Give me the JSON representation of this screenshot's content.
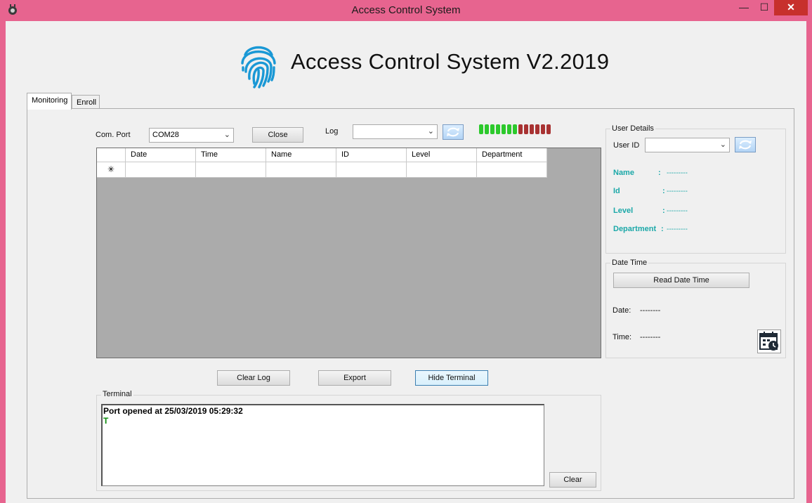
{
  "window": {
    "title": "Access Control System",
    "minimize_glyph": "—",
    "maximize_glyph": "☐",
    "close_glyph": "✕"
  },
  "header": {
    "title": "Access Control System V2.2019",
    "logo_icon": "fingerprint-icon",
    "logo_color": "#1a98d5"
  },
  "tabs": [
    {
      "label": "Monitoring",
      "active": true
    },
    {
      "label": "Enroll",
      "active": false
    }
  ],
  "connection": {
    "port_label": "Com. Port",
    "port_value": "COM28",
    "close_label": "Close",
    "log_label": "Log",
    "log_value": ""
  },
  "leds": {
    "colors": [
      "#2cc92c",
      "#2cc92c",
      "#2cc92c",
      "#2cc92c",
      "#2cc92c",
      "#2cc92c",
      "#2cc92c",
      "#a83232",
      "#a83232",
      "#a83232",
      "#a83232",
      "#a83232",
      "#a83232"
    ]
  },
  "grid": {
    "columns": [
      "Date",
      "Time",
      "Name",
      "ID",
      "Level",
      "Department"
    ],
    "new_row_marker": "✳",
    "rows": []
  },
  "actions": {
    "clear_log": "Clear Log",
    "export": "Export",
    "hide_terminal": "Hide Terminal"
  },
  "terminal": {
    "title": "Terminal",
    "lines": [
      "Port opened at 25/03/2019 05:29:32",
      "T"
    ],
    "clear_label": "Clear"
  },
  "user_details": {
    "title": "User Details",
    "user_id_label": "User ID",
    "user_id_value": "",
    "fields": [
      {
        "key": "Name",
        "sep": ":",
        "value": "---------"
      },
      {
        "key": "Id",
        "sep": ":",
        "value": "---------"
      },
      {
        "key": "Level",
        "sep": ":",
        "value": "---------"
      },
      {
        "key": "Department",
        "sep": ":",
        "value": "---------"
      }
    ]
  },
  "date_time": {
    "title": "Date Time",
    "read_button": "Read Date Time",
    "date_label": "Date:",
    "date_value": "--------",
    "time_label": "Time:",
    "time_value": "--------"
  }
}
